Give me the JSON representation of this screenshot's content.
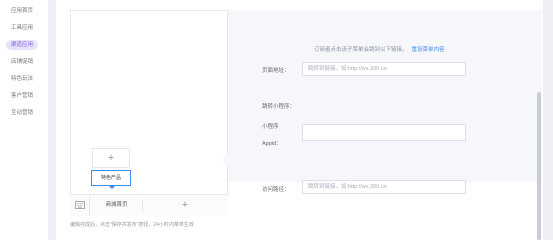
{
  "sidebar": {
    "items": [
      {
        "label": "应用首页",
        "active": false
      },
      {
        "label": "工具应用",
        "active": false
      },
      {
        "label": "渠道应用",
        "active": true
      },
      {
        "label": "店铺促销",
        "active": false
      },
      {
        "label": "特色玩法",
        "active": false
      },
      {
        "label": "客户营销",
        "active": false
      },
      {
        "label": "互动营销",
        "active": false
      }
    ]
  },
  "preview": {
    "menu_add_symbol": "+",
    "submenu_item": "特色产品",
    "bottom_menu": {
      "keyboard_icon": "keyboard-icon",
      "item1": "商城首页",
      "item2_symbol": "+"
    }
  },
  "settings": {
    "tip_text": "订阅者点击该子菜单会跳到以下链接。",
    "tip_link": "重设菜单内容",
    "page_url_label": "页面地址：",
    "page_url_placeholder": "跳转到链接，如:http://wx.300.cn",
    "mini_program_label": "跳转小程序：",
    "appid_label_line1": "小程序",
    "appid_label_line2": "Appid：",
    "appid_value": "",
    "path_label": "访问路径：",
    "path_placeholder": "跳转到链接，如:http://wx.300.cn"
  },
  "footer_note": "编辑完成后，点击“保存并发布”按钮，24小时内菜单生效",
  "colors": {
    "accent": "#7a64d8",
    "link": "#3f8cf0",
    "active_bg": "#e7e3fb"
  }
}
